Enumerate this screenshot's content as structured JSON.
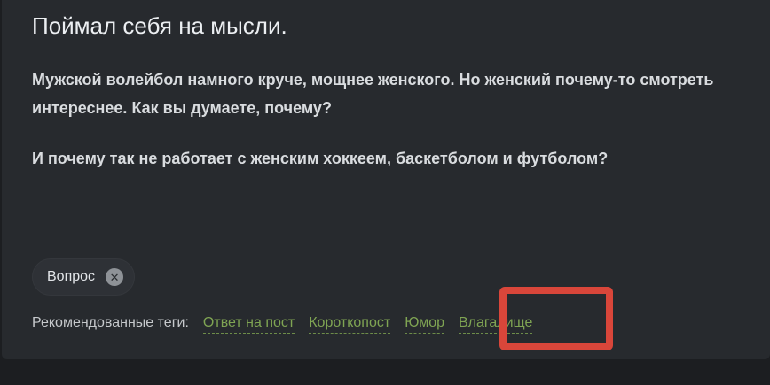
{
  "post": {
    "title": "Поймал себя на мысли.",
    "paragraph_1": "Мужской волейбол намного круче, мощнее женского. Но женский почему-то смотреть интереснее. Как вы думаете, почему?",
    "paragraph_2": "И почему так не работает с женским хоккеем, баскетболом и футболом?"
  },
  "tags": {
    "selected": [
      {
        "label": "Вопрос",
        "remove_icon": "close-circle-icon"
      }
    ]
  },
  "recommended_tags": {
    "label": "Рекомендованные теги:",
    "items": [
      "Ответ на пост",
      "Короткопост",
      "Юмор",
      "Влагалище"
    ]
  },
  "annotation": {
    "highlight_color": "#d9463a",
    "highlighted_tag": "Влагалище"
  },
  "colors": {
    "background": "#1c1e21",
    "card": "#272a2e",
    "tag_link": "#7fa453"
  }
}
